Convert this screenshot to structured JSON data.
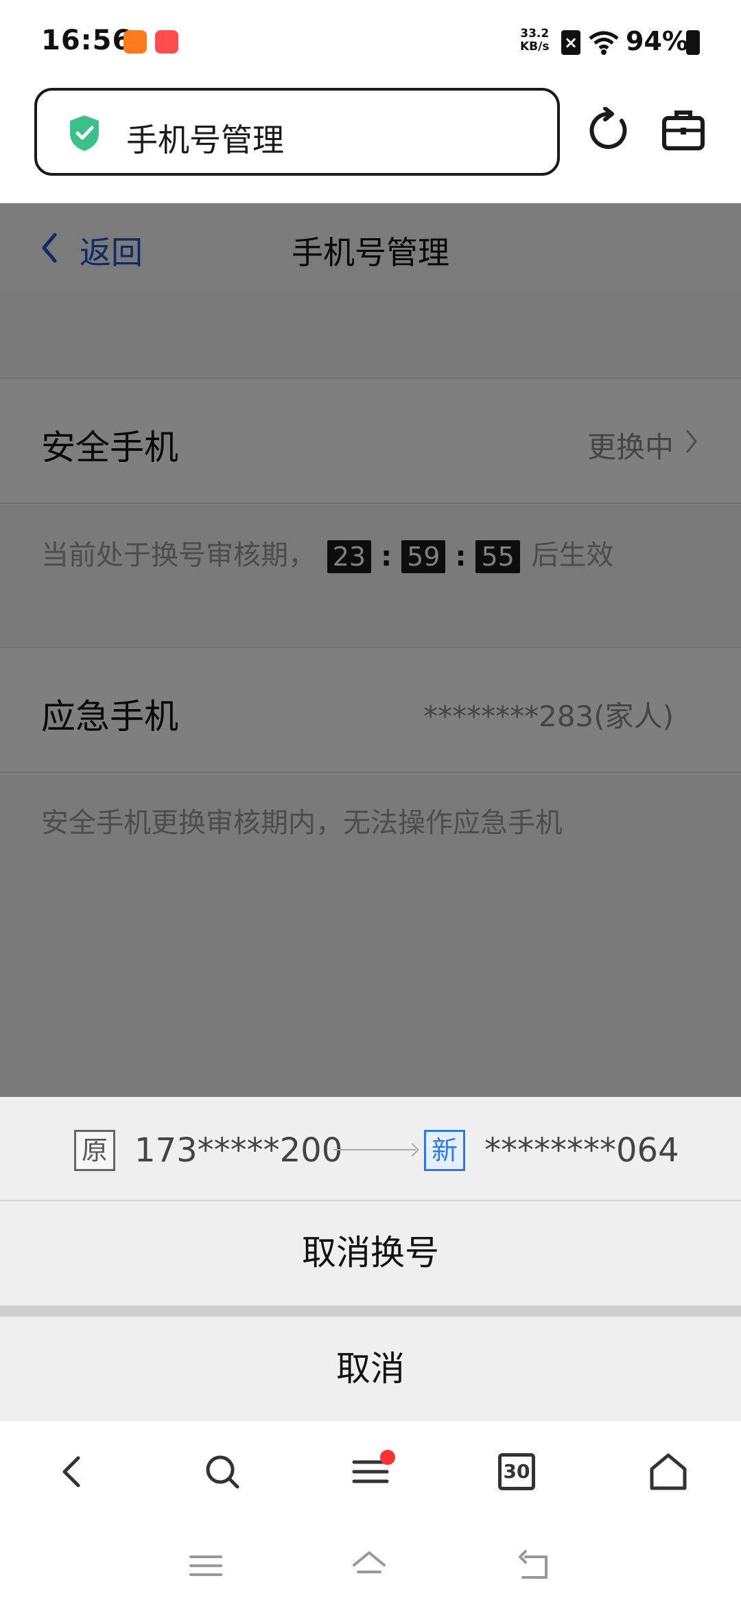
{
  "status_bar": {
    "time": "16:56",
    "net_speed_value": "33.2",
    "net_speed_unit": "KB/s",
    "battery": "94%"
  },
  "browser": {
    "address_title": "手机号管理"
  },
  "page": {
    "back_label": "返回",
    "title": "手机号管理",
    "security_phone_label": "安全手机",
    "security_phone_value": "更换中",
    "review_prefix": "当前处于换号审核期，",
    "countdown": {
      "hours": "23",
      "minutes": "59",
      "seconds": "55"
    },
    "review_suffix": "后生效",
    "emergency_phone_label": "应急手机",
    "emergency_phone_value": "********283(家人)",
    "emergency_note": "安全手机更换审核期内，无法操作应急手机"
  },
  "sheet": {
    "old_tag": "原",
    "old_number": "173*****200",
    "new_tag": "新",
    "new_number": "********064",
    "cancel_change_label": "取消换号",
    "cancel_label": "取消"
  },
  "browser_nav": {
    "tabs_count": "30"
  },
  "colors": {
    "link_blue": "#1a56c8",
    "shield_green": "#3cc08a",
    "badge_red": "#ff3333",
    "new_tag_blue": "#2a7ae2"
  }
}
